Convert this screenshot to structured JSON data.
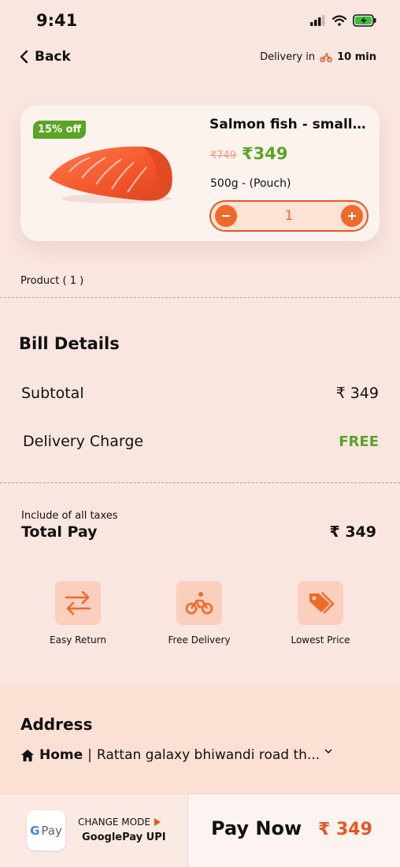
{
  "status": {
    "time": "9:41"
  },
  "header": {
    "back_label": "Back",
    "delivery_prefix": "Delivery in",
    "delivery_time": "10 min"
  },
  "product": {
    "badge": "15% off",
    "title": "Salmon fish - small...",
    "old_price": "₹749",
    "price": "₹349",
    "variant": "500g - (Pouch)",
    "quantity": "1"
  },
  "product_count": "Product ( 1 )",
  "bill": {
    "title": "Bill Details",
    "subtotal_label": "Subtotal",
    "subtotal_value": "₹ 349",
    "delivery_label": "Delivery Charge",
    "delivery_value": "FREE",
    "taxes_note": "Include of all taxes",
    "total_label": "Total Pay",
    "total_value": "₹ 349"
  },
  "features": [
    {
      "label": "Easy Return",
      "icon": "swap-arrows-icon"
    },
    {
      "label": "Free Delivery",
      "icon": "scooter-icon"
    },
    {
      "label": "Lowest Price",
      "icon": "price-tag-icon"
    }
  ],
  "address": {
    "title": "Address",
    "type": "Home",
    "text": "Rattan galaxy bhiwandi road th..."
  },
  "payment": {
    "gpay_label": "Pay",
    "change_mode": "CHANGE MODE",
    "method": "GooglePay UPI",
    "pay_now": "Pay Now",
    "amount": "₹ 349"
  },
  "colors": {
    "background": "#f9e6e0",
    "accent": "#e8561f",
    "green": "#5aa524"
  }
}
